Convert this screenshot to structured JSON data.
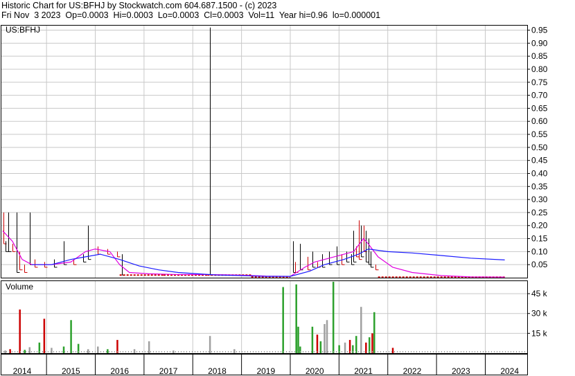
{
  "header": {
    "line1": "Historic Chart for US:BFHJ by Stockwatch.com 604.687.1500 - (c) 2023",
    "line2": "Fri Nov  3 2023  Op=0.0003  Hi=0.0003  Lo=0.0003  Cl=0.0003  Vol=11  Year hi=0.96  lo=0.000001"
  },
  "chart_data": [
    {
      "type": "line",
      "title": "US:BFHJ",
      "ylim": [
        0,
        0.97
      ],
      "y_ticks": [
        "0.95",
        "0.90",
        "0.85",
        "0.80",
        "0.75",
        "0.70",
        "0.65",
        "0.60",
        "0.55",
        "0.50",
        "0.45",
        "0.40",
        "0.35",
        "0.30",
        "0.25",
        "0.20",
        "0.15",
        "0.10",
        "0.05"
      ],
      "grid": true,
      "price_bars": [
        {
          "x": 2013.62,
          "hi": 0.25,
          "lo": 0.13,
          "c": "red"
        },
        {
          "x": 2013.66,
          "hi": 0.14,
          "lo": 0.1,
          "c": "black"
        },
        {
          "x": 2013.72,
          "hi": 0.25,
          "lo": 0.1,
          "c": "black"
        },
        {
          "x": 2013.8,
          "hi": 0.13,
          "lo": 0.1,
          "c": "red"
        },
        {
          "x": 2013.88,
          "hi": 0.25,
          "lo": 0.02,
          "c": "black"
        },
        {
          "x": 2013.95,
          "hi": 0.1,
          "lo": 0.03,
          "c": "red"
        },
        {
          "x": 2014.05,
          "hi": 0.05,
          "lo": 0.02,
          "c": "red"
        },
        {
          "x": 2014.15,
          "hi": 0.25,
          "lo": 0.05,
          "c": "black"
        },
        {
          "x": 2014.25,
          "hi": 0.07,
          "lo": 0.04,
          "c": "red"
        },
        {
          "x": 2014.45,
          "hi": 0.06,
          "lo": 0.04,
          "c": "red"
        },
        {
          "x": 2014.65,
          "hi": 0.07,
          "lo": 0.04,
          "c": "black"
        },
        {
          "x": 2014.85,
          "hi": 0.14,
          "lo": 0.05,
          "c": "black"
        },
        {
          "x": 2015.05,
          "hi": 0.07,
          "lo": 0.05,
          "c": "red"
        },
        {
          "x": 2015.25,
          "hi": 0.09,
          "lo": 0.06,
          "c": "black"
        },
        {
          "x": 2015.35,
          "hi": 0.2,
          "lo": 0.07,
          "c": "black"
        },
        {
          "x": 2015.55,
          "hi": 0.12,
          "lo": 0.09,
          "c": "red"
        },
        {
          "x": 2015.75,
          "hi": 0.11,
          "lo": 0.09,
          "c": "red"
        },
        {
          "x": 2015.95,
          "hi": 0.1,
          "lo": 0.08,
          "c": "red"
        },
        {
          "x": 2016.05,
          "hi": 0.09,
          "lo": 0.01,
          "c": "black"
        },
        {
          "x": 2017.85,
          "hi": 0.96,
          "lo": 0.01,
          "c": "black"
        },
        {
          "x": 2019.55,
          "hi": 0.14,
          "lo": 0.02,
          "c": "black"
        },
        {
          "x": 2019.6,
          "hi": 0.06,
          "lo": 0.02,
          "c": "red"
        },
        {
          "x": 2019.7,
          "hi": 0.13,
          "lo": 0.03,
          "c": "black"
        },
        {
          "x": 2019.85,
          "hi": 0.08,
          "lo": 0.03,
          "c": "red"
        },
        {
          "x": 2019.95,
          "hi": 0.1,
          "lo": 0.04,
          "c": "black"
        },
        {
          "x": 2020.05,
          "hi": 0.06,
          "lo": 0.04,
          "c": "red"
        },
        {
          "x": 2020.15,
          "hi": 0.09,
          "lo": 0.04,
          "c": "black"
        },
        {
          "x": 2020.3,
          "hi": 0.1,
          "lo": 0.05,
          "c": "black"
        },
        {
          "x": 2020.45,
          "hi": 0.12,
          "lo": 0.05,
          "c": "black"
        },
        {
          "x": 2020.55,
          "hi": 0.09,
          "lo": 0.05,
          "c": "red"
        },
        {
          "x": 2020.65,
          "hi": 0.1,
          "lo": 0.06,
          "c": "black"
        },
        {
          "x": 2020.75,
          "hi": 0.09,
          "lo": 0.05,
          "c": "black"
        },
        {
          "x": 2020.8,
          "hi": 0.18,
          "lo": 0.06,
          "c": "black"
        },
        {
          "x": 2020.85,
          "hi": 0.12,
          "lo": 0.08,
          "c": "red"
        },
        {
          "x": 2020.9,
          "hi": 0.22,
          "lo": 0.07,
          "c": "red"
        },
        {
          "x": 2020.95,
          "hi": 0.2,
          "lo": 0.08,
          "c": "black"
        },
        {
          "x": 2021.0,
          "hi": 0.2,
          "lo": 0.1,
          "c": "red"
        },
        {
          "x": 2021.05,
          "hi": 0.18,
          "lo": 0.06,
          "c": "black"
        },
        {
          "x": 2021.1,
          "hi": 0.15,
          "lo": 0.05,
          "c": "black"
        },
        {
          "x": 2021.15,
          "hi": 0.1,
          "lo": 0.04,
          "c": "black"
        },
        {
          "x": 2021.25,
          "hi": 0.05,
          "lo": 0.03,
          "c": "red"
        }
      ],
      "flat_segments": [
        {
          "x0": 2016.0,
          "x1": 2016.9,
          "y": 0.01
        },
        {
          "x0": 2016.9,
          "x1": 2017.8,
          "y": 0.01
        },
        {
          "x0": 2017.8,
          "x1": 2018.7,
          "y": 0.01
        },
        {
          "x0": 2018.7,
          "x1": 2019.5,
          "y": 0.003
        },
        {
          "x0": 2021.3,
          "x1": 2023.9,
          "y": 0.002
        }
      ],
      "ma_short": [
        [
          2013.6,
          0.18
        ],
        [
          2013.8,
          0.14
        ],
        [
          2014.0,
          0.07
        ],
        [
          2014.2,
          0.05
        ],
        [
          2014.6,
          0.05
        ],
        [
          2015.0,
          0.06
        ],
        [
          2015.3,
          0.1
        ],
        [
          2015.5,
          0.11
        ],
        [
          2015.8,
          0.1
        ],
        [
          2016.0,
          0.05
        ],
        [
          2016.2,
          0.02
        ],
        [
          2016.6,
          0.015
        ],
        [
          2017.2,
          0.012
        ],
        [
          2017.8,
          0.012
        ],
        [
          2018.4,
          0.01
        ],
        [
          2019.0,
          0.006
        ],
        [
          2019.5,
          0.005
        ],
        [
          2019.8,
          0.04
        ],
        [
          2020.0,
          0.06
        ],
        [
          2020.4,
          0.08
        ],
        [
          2020.8,
          0.1
        ],
        [
          2021.0,
          0.15
        ],
        [
          2021.1,
          0.13
        ],
        [
          2021.3,
          0.08
        ],
        [
          2021.6,
          0.04
        ],
        [
          2022.0,
          0.02
        ],
        [
          2022.6,
          0.008
        ],
        [
          2023.2,
          0.003
        ],
        [
          2023.9,
          0.002
        ]
      ],
      "ma_long": [
        [
          2014.2,
          0.05
        ],
        [
          2014.6,
          0.05
        ],
        [
          2015.0,
          0.07
        ],
        [
          2015.3,
          0.08
        ],
        [
          2015.6,
          0.09
        ],
        [
          2016.0,
          0.07
        ],
        [
          2016.4,
          0.045
        ],
        [
          2016.8,
          0.03
        ],
        [
          2017.2,
          0.02
        ],
        [
          2017.6,
          0.015
        ],
        [
          2018.0,
          0.01
        ],
        [
          2018.5,
          0.008
        ],
        [
          2019.0,
          0.005
        ],
        [
          2019.5,
          0.005
        ],
        [
          2019.9,
          0.025
        ],
        [
          2020.2,
          0.05
        ],
        [
          2020.6,
          0.07
        ],
        [
          2020.9,
          0.09
        ],
        [
          2021.1,
          0.11
        ],
        [
          2021.5,
          0.1
        ],
        [
          2022.0,
          0.095
        ],
        [
          2022.6,
          0.085
        ],
        [
          2023.2,
          0.075
        ],
        [
          2023.9,
          0.068
        ]
      ]
    },
    {
      "type": "bar",
      "title": "Volume",
      "ylim": [
        0,
        55000
      ],
      "y_ticks": [
        "45 k",
        "30 k",
        "15 k"
      ],
      "x_ticks": [
        "2014",
        "2015",
        "2016",
        "2017",
        "2018",
        "2019",
        "2020",
        "2021",
        "2022",
        "2023",
        "2024"
      ],
      "bars": [
        {
          "x": 2013.65,
          "v": 2000,
          "c": "gray"
        },
        {
          "x": 2013.75,
          "v": 3000,
          "c": "red"
        },
        {
          "x": 2013.95,
          "v": 33000,
          "c": "red"
        },
        {
          "x": 2014.05,
          "v": 2500,
          "c": "green"
        },
        {
          "x": 2014.15,
          "v": 4500,
          "c": "gray"
        },
        {
          "x": 2014.35,
          "v": 8000,
          "c": "green"
        },
        {
          "x": 2014.45,
          "v": 26000,
          "c": "red"
        },
        {
          "x": 2014.6,
          "v": 4000,
          "c": "gray"
        },
        {
          "x": 2014.85,
          "v": 5000,
          "c": "green"
        },
        {
          "x": 2015.0,
          "v": 25000,
          "c": "green"
        },
        {
          "x": 2015.15,
          "v": 7000,
          "c": "green"
        },
        {
          "x": 2015.35,
          "v": 3000,
          "c": "gray"
        },
        {
          "x": 2015.55,
          "v": 5000,
          "c": "gray"
        },
        {
          "x": 2015.75,
          "v": 3000,
          "c": "green"
        },
        {
          "x": 2015.95,
          "v": 10000,
          "c": "red"
        },
        {
          "x": 2016.3,
          "v": 3000,
          "c": "gray"
        },
        {
          "x": 2016.6,
          "v": 9000,
          "c": "gray"
        },
        {
          "x": 2017.1,
          "v": 2000,
          "c": "gray"
        },
        {
          "x": 2017.85,
          "v": 13000,
          "c": "gray"
        },
        {
          "x": 2018.35,
          "v": 3000,
          "c": "gray"
        },
        {
          "x": 2019.35,
          "v": 50000,
          "c": "green"
        },
        {
          "x": 2019.62,
          "v": 52000,
          "c": "green"
        },
        {
          "x": 2019.66,
          "v": 20000,
          "c": "green"
        },
        {
          "x": 2019.7,
          "v": 5000,
          "c": "green"
        },
        {
          "x": 2019.95,
          "v": 20000,
          "c": "green"
        },
        {
          "x": 2020.05,
          "v": 14000,
          "c": "red"
        },
        {
          "x": 2020.12,
          "v": 9000,
          "c": "green"
        },
        {
          "x": 2020.2,
          "v": 22000,
          "c": "gray"
        },
        {
          "x": 2020.25,
          "v": 25000,
          "c": "gray"
        },
        {
          "x": 2020.38,
          "v": 54000,
          "c": "green"
        },
        {
          "x": 2020.5,
          "v": 6000,
          "c": "green"
        },
        {
          "x": 2020.62,
          "v": 8000,
          "c": "gray"
        },
        {
          "x": 2020.72,
          "v": 10000,
          "c": "red"
        },
        {
          "x": 2020.78,
          "v": 6000,
          "c": "green"
        },
        {
          "x": 2020.85,
          "v": 13000,
          "c": "green"
        },
        {
          "x": 2020.95,
          "v": 35000,
          "c": "gray"
        },
        {
          "x": 2021.05,
          "v": 8000,
          "c": "red"
        },
        {
          "x": 2021.12,
          "v": 12000,
          "c": "green"
        },
        {
          "x": 2021.18,
          "v": 15000,
          "c": "red"
        },
        {
          "x": 2021.22,
          "v": 31000,
          "c": "green"
        },
        {
          "x": 2021.6,
          "v": 4000,
          "c": "red"
        }
      ],
      "baseline_dashes": true
    }
  ]
}
